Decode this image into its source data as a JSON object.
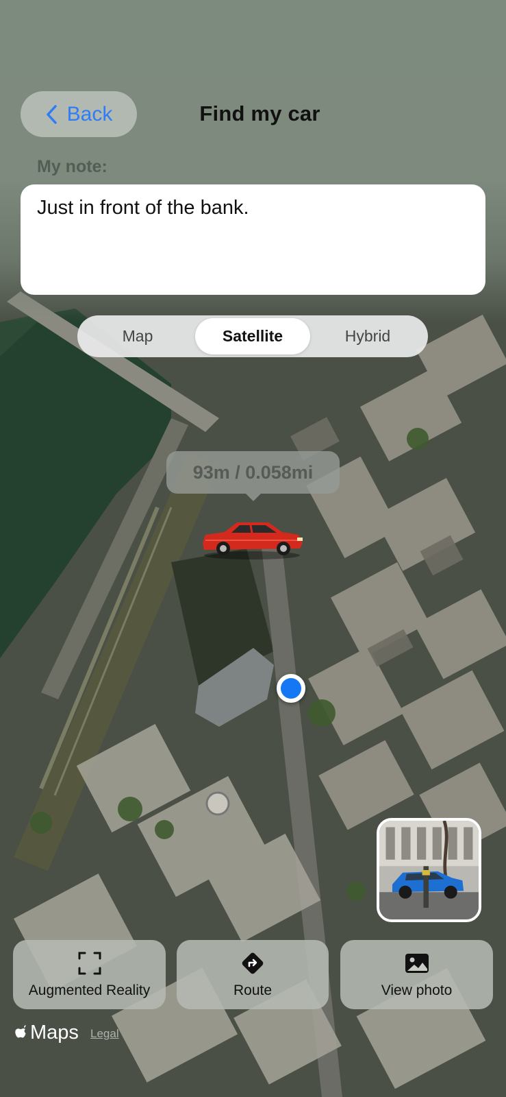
{
  "header": {
    "back_label": "Back",
    "title": "Find my car"
  },
  "note": {
    "label": "My note:",
    "text": "Just in front of the bank."
  },
  "map_type": {
    "options": [
      "Map",
      "Satellite",
      "Hybrid"
    ],
    "selected": "Satellite"
  },
  "distance": "93m / 0.058mi",
  "actions": {
    "ar_label": "Augmented Reality",
    "route_label": "Route",
    "photo_label": "View photo"
  },
  "attribution": {
    "maps_label": "Maps",
    "legal_label": "Legal"
  },
  "icons": {
    "back": "chevron-left-icon",
    "ar": "ar-frame-icon",
    "route": "route-diamond-icon",
    "photo": "photo-icon",
    "apple": "apple-logo-icon",
    "car": "red-car-icon"
  },
  "colors": {
    "accent": "#2f7cf6",
    "user_location": "#1677f5",
    "car": "#d42a1e"
  }
}
